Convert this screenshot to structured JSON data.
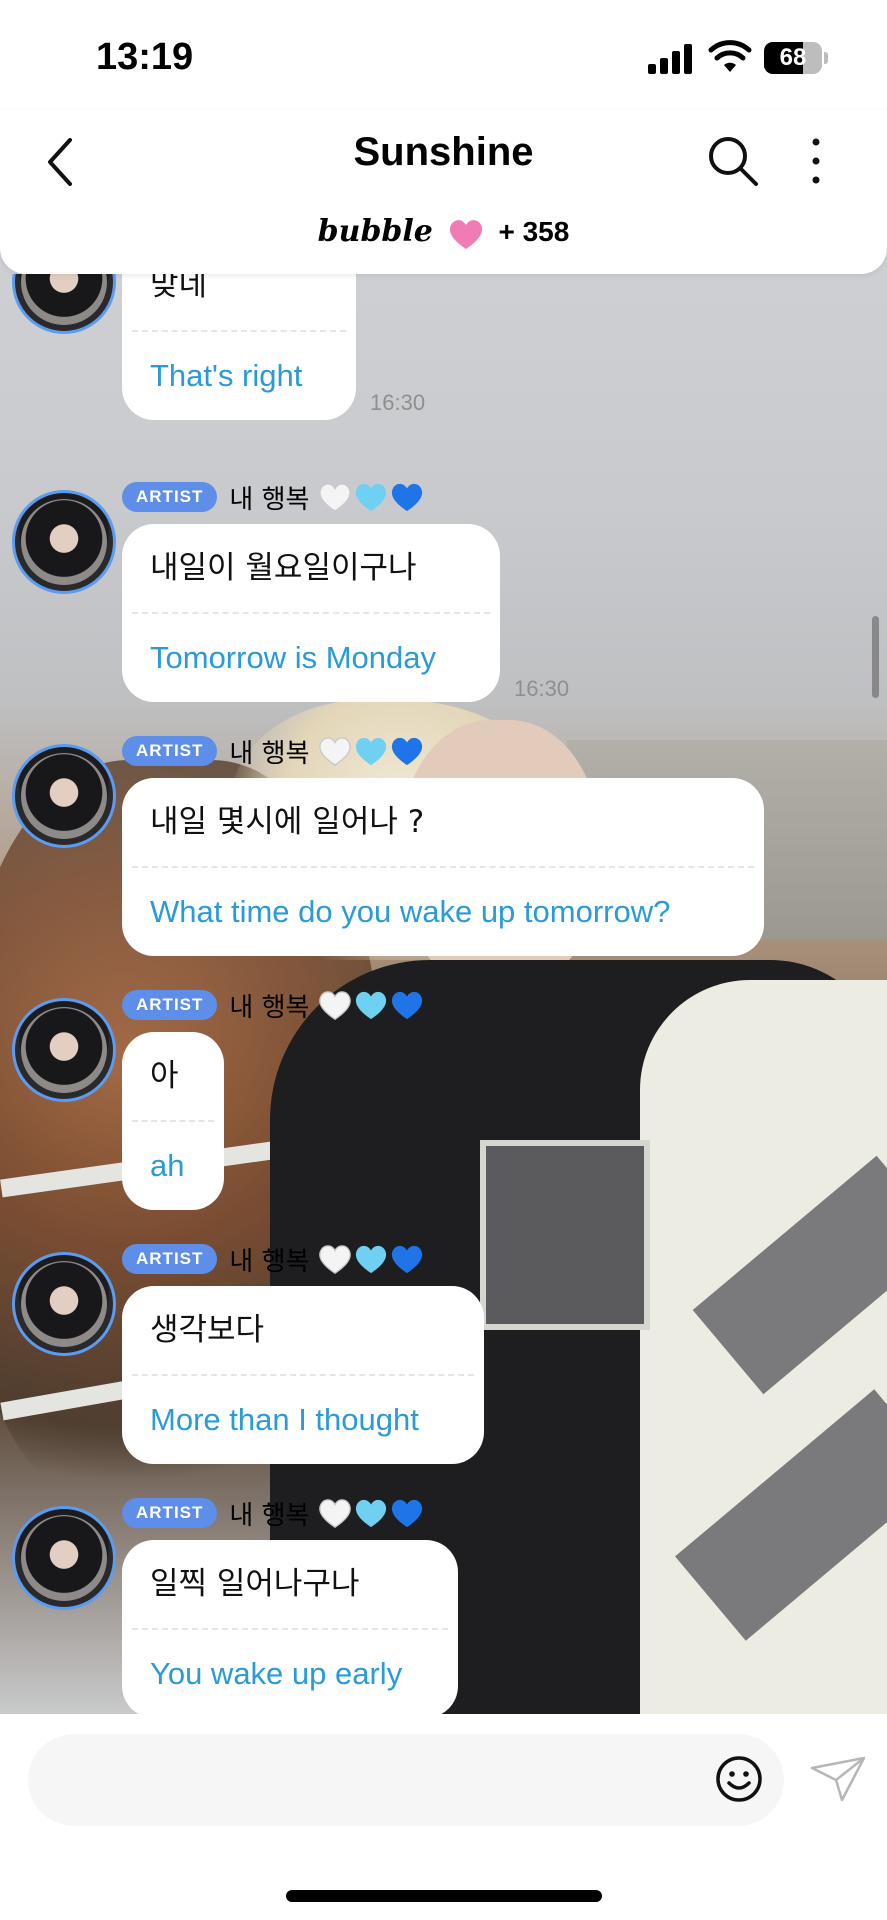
{
  "status_bar": {
    "time": "13:19",
    "battery": "68",
    "battery_level": 0.68
  },
  "header": {
    "title": "Sunshine",
    "brand": "bubble",
    "member_count": "+ 358"
  },
  "chat": {
    "messages": [
      {
        "badge": "",
        "nickname": "",
        "korean": "맞네",
        "english": "That's right",
        "time": "16:30"
      },
      {
        "badge": "ARTIST",
        "nickname": "내 행복",
        "korean": "내일이 월요일이구나",
        "english": "Tomorrow is Monday",
        "time": "16:30"
      },
      {
        "badge": "ARTIST",
        "nickname": "내 행복",
        "korean": "내일 몇시에 일어나 ?",
        "english": "What time do you wake up tomorrow?",
        "time": ""
      },
      {
        "badge": "ARTIST",
        "nickname": "내 행복",
        "korean": "아",
        "english": "ah",
        "time": ""
      },
      {
        "badge": "ARTIST",
        "nickname": "내 행복",
        "korean": "생각보다",
        "english": "More than I thought",
        "time": ""
      },
      {
        "badge": "ARTIST",
        "nickname": "내 행복",
        "korean": "일찍 일어나구나",
        "english": "You wake up early",
        "time": ""
      }
    ]
  },
  "colors": {
    "accent_blue": "#5e8ee8",
    "translation_text": "#2a9bd6",
    "heart_pink": "#f07cb6"
  },
  "icons": [
    "back-chevron-icon",
    "search-icon",
    "more-vertical-icon",
    "pink-heart-icon",
    "white-heart-icon",
    "light-blue-heart-icon",
    "blue-heart-icon",
    "emoji-icon",
    "send-icon"
  ]
}
